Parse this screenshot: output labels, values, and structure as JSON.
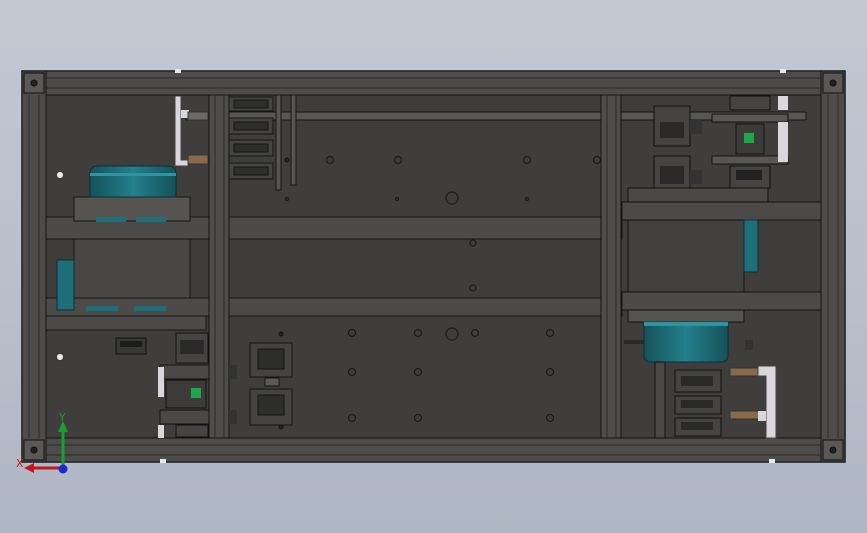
{
  "viewport": {
    "background_top": "#c3c9d3",
    "background_bottom": "#b0b7c4"
  },
  "model": {
    "frame_color": "#4a4a48",
    "frame_edge": "#1a1a1a",
    "panel_color": "#3f3e3c",
    "motor_color": "#1f6f7a",
    "light_part_color": "#d8d8dc",
    "accent_green": "#1fa84a"
  },
  "triad": {
    "x_label": "X",
    "y_label": "Y",
    "x_color": "#c0181a",
    "y_color": "#18a030",
    "z_color": "#1a2ad0"
  }
}
